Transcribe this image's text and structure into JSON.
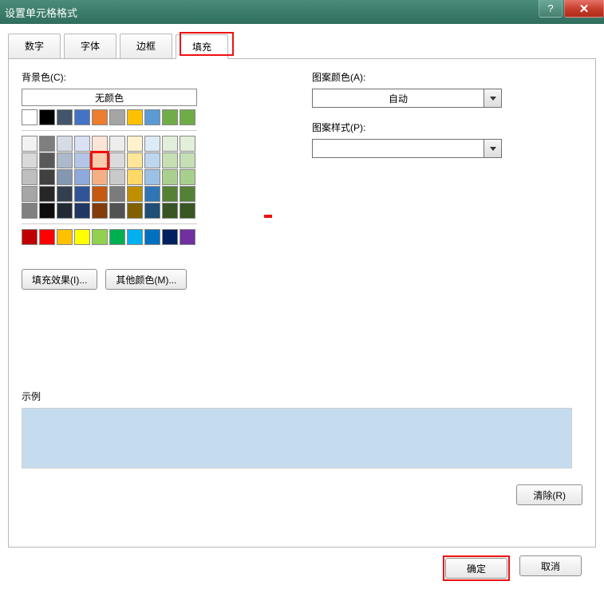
{
  "window": {
    "title": "设置单元格格式",
    "faded": ""
  },
  "tabs": {
    "number": "数字",
    "font": "字体",
    "border": "边框",
    "fill": "填充"
  },
  "labels": {
    "bg_color": "背景色(C):",
    "no_color": "无颜色",
    "pattern_color": "图案颜色(A):",
    "auto": "自动",
    "pattern_style": "图案样式(P):",
    "example": "示例"
  },
  "buttons": {
    "fill_effects": "填充效果(I)...",
    "more_colors": "其他颜色(M)...",
    "clear": "清除(R)",
    "ok": "确定",
    "cancel": "取消"
  },
  "palette": {
    "theme_row": [
      "#ffffff",
      "#000000",
      "#44546a",
      "#4472c4",
      "#ed7d31",
      "#a5a5a5",
      "#ffc000",
      "#5b9bd5",
      "#70ad47",
      "#6fac46"
    ],
    "shades": [
      [
        "#f2f2f2",
        "#7f7f7f",
        "#d6dce5",
        "#d9e1f2",
        "#fce4d6",
        "#ededed",
        "#fff2cc",
        "#ddebf7",
        "#e2efda",
        "#e2f0d9"
      ],
      [
        "#d9d9d9",
        "#595959",
        "#acb9ca",
        "#b4c6e7",
        "#f8cbad",
        "#dbdbdb",
        "#ffe699",
        "#bdd7ee",
        "#c6e0b4",
        "#c5e0b4"
      ],
      [
        "#bfbfbf",
        "#404040",
        "#8497b0",
        "#8ea9db",
        "#f4b084",
        "#c9c9c9",
        "#ffd966",
        "#9bc2e6",
        "#a9d08e",
        "#a8d08d"
      ],
      [
        "#a6a6a6",
        "#262626",
        "#333f4f",
        "#305496",
        "#c65911",
        "#7b7b7b",
        "#bf8f00",
        "#2f75b5",
        "#548235",
        "#538135"
      ],
      [
        "#808080",
        "#0d0d0d",
        "#222b35",
        "#203764",
        "#833c0c",
        "#525252",
        "#806000",
        "#1f4e78",
        "#375623",
        "#385723"
      ]
    ],
    "standard": [
      "#c00000",
      "#ff0000",
      "#ffc000",
      "#ffff00",
      "#92d050",
      "#00b050",
      "#00b0f0",
      "#0070c0",
      "#002060",
      "#7030a0"
    ],
    "selected": [
      1,
      4
    ]
  },
  "example_fill": "#c5dcef"
}
